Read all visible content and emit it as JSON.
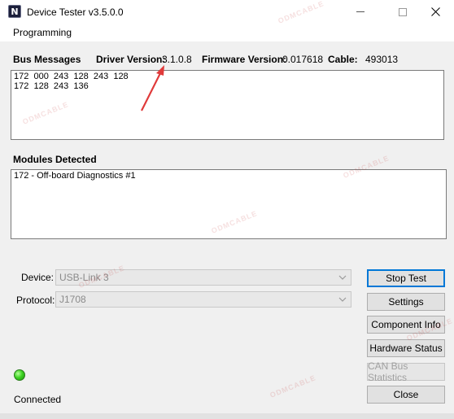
{
  "window": {
    "icon_letter": "N",
    "title": "Device Tester  v3.5.0.0",
    "minimize_glyph": "—",
    "maximize_glyph": "☐"
  },
  "menu": {
    "items": [
      {
        "label": "Programming"
      }
    ]
  },
  "info": {
    "bus_messages_label": "Bus Messages",
    "driver_version_label": "Driver Version:",
    "driver_version": "3.1.0.8",
    "firmware_version_label": "Firmware Version:",
    "firmware_version": "0.017618",
    "cable_label": "Cable:",
    "cable": "493013"
  },
  "bus_messages": {
    "lines": [
      "172  000  243  128  243  128",
      "172  128  243  136"
    ]
  },
  "modules": {
    "label": "Modules Detected",
    "items": [
      "172 - Off-board Diagnostics #1"
    ]
  },
  "device": {
    "label": "Device:",
    "value": "USB-Link 3"
  },
  "protocol": {
    "label": "Protocol:",
    "value": "J1708"
  },
  "buttons": {
    "stop_test": "Stop Test",
    "settings": "Settings",
    "component_info": "Component Info",
    "hardware_status": "Hardware Status",
    "can_bus_statistics": "CAN Bus Statistics",
    "close": "Close"
  },
  "status": {
    "text": "Connected",
    "led_color": "#3fd424"
  },
  "colors": {
    "accent": "#0078d7",
    "annotation_arrow": "#e03a3a"
  },
  "watermark": "ODMCABLE"
}
